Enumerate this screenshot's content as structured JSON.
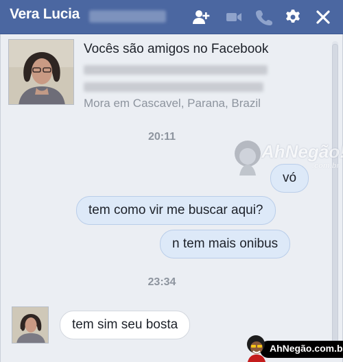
{
  "header": {
    "name": "Vera Lucia",
    "icons": [
      "add-friend-icon",
      "video-call-icon",
      "phone-icon",
      "gear-icon",
      "close-icon"
    ],
    "color": "#4b67a1"
  },
  "intro": {
    "friends_text": "Vocês são amigos no Facebook",
    "location_text": "Mora em Cascavel, Parana, Brazil"
  },
  "messages": {
    "time1": "20:11",
    "time2": "23:34",
    "out1": "vó",
    "out2": "tem como vir me buscar aqui?",
    "out3": "n tem mais onibus",
    "in1": "tem sim seu bosta"
  },
  "watermark": {
    "brand": "AhNegão!",
    "sub": ".com.br",
    "footer": "AhNegão.com.br"
  },
  "colors": {
    "outgoing_bubble": "#dde9f8",
    "incoming_bubble": "#ffffff",
    "panel_bg": "#ebeef3"
  }
}
